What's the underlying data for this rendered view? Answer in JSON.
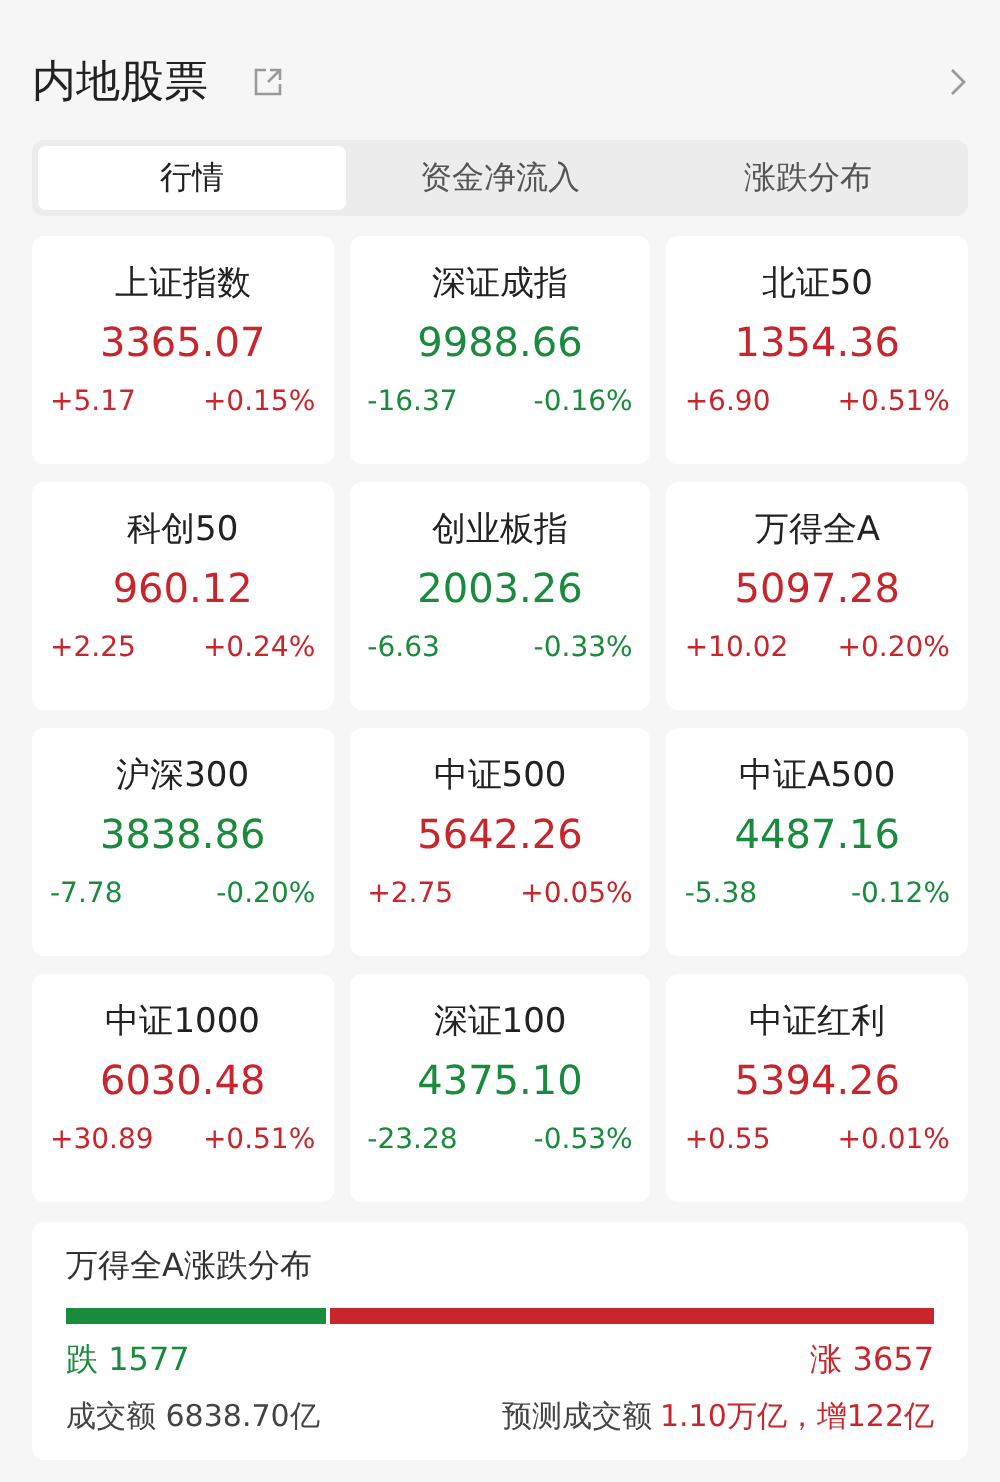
{
  "header": {
    "title": "内地股票"
  },
  "tabs": [
    {
      "label": "行情",
      "selected": true
    },
    {
      "label": "资金净流入",
      "selected": false
    },
    {
      "label": "涨跌分布",
      "selected": false
    }
  ],
  "indices": [
    {
      "name": "上证指数",
      "value": "3365.07",
      "change": "+5.17",
      "percent": "+0.15%",
      "color": "#c8252c"
    },
    {
      "name": "深证成指",
      "value": "9988.66",
      "change": "-16.37",
      "percent": "-0.16%",
      "color": "#1a8a3c"
    },
    {
      "name": "北证50",
      "value": "1354.36",
      "change": "+6.90",
      "percent": "+0.51%",
      "color": "#c8252c"
    },
    {
      "name": "科创50",
      "value": "960.12",
      "change": "+2.25",
      "percent": "+0.24%",
      "color": "#c8252c"
    },
    {
      "name": "创业板指",
      "value": "2003.26",
      "change": "-6.63",
      "percent": "-0.33%",
      "color": "#1a8a3c"
    },
    {
      "name": "万得全A",
      "value": "5097.28",
      "change": "+10.02",
      "percent": "+0.20%",
      "color": "#c8252c"
    },
    {
      "name": "沪深300",
      "value": "3838.86",
      "change": "-7.78",
      "percent": "-0.20%",
      "color": "#1a8a3c"
    },
    {
      "name": "中证500",
      "value": "5642.26",
      "change": "+2.75",
      "percent": "+0.05%",
      "color": "#c8252c"
    },
    {
      "name": "中证A500",
      "value": "4487.16",
      "change": "-5.38",
      "percent": "-0.12%",
      "color": "#1a8a3c"
    },
    {
      "name": "中证1000",
      "value": "6030.48",
      "change": "+30.89",
      "percent": "+0.51%",
      "color": "#c8252c"
    },
    {
      "name": "深证100",
      "value": "4375.10",
      "change": "-23.28",
      "percent": "-0.53%",
      "color": "#1a8a3c"
    },
    {
      "name": "中证红利",
      "value": "5394.26",
      "change": "+0.55",
      "percent": "+0.01%",
      "color": "#c8252c"
    }
  ],
  "distribution": {
    "title": "万得全A涨跌分布",
    "level": 0.3,
    "down": "跌 1577",
    "up": "涨 3657",
    "turnover": "成交额 6838.70亿",
    "forecast_label": "预测成交额",
    "forecast_value": "1.10万亿，增122亿"
  }
}
